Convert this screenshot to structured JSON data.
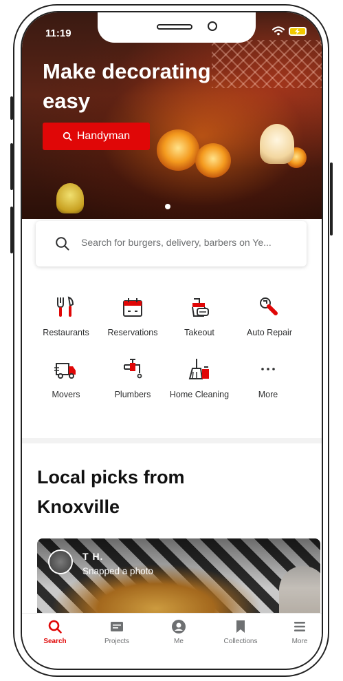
{
  "status_bar": {
    "time": "11:19"
  },
  "hero": {
    "title": "Make decorating easy",
    "button_label": "Handyman"
  },
  "search": {
    "placeholder": "Search for burgers, delivery, barbers on Ye..."
  },
  "categories": [
    {
      "label": "Restaurants",
      "icon": "utensils-icon"
    },
    {
      "label": "Reservations",
      "icon": "calendar-icon"
    },
    {
      "label": "Takeout",
      "icon": "takeout-icon"
    },
    {
      "label": "Auto Repair",
      "icon": "wrench-icon"
    },
    {
      "label": "Movers",
      "icon": "truck-icon"
    },
    {
      "label": "Plumbers",
      "icon": "faucet-icon"
    },
    {
      "label": "Home Cleaning",
      "icon": "broom-icon"
    },
    {
      "label": "More",
      "icon": "more-dots-icon"
    }
  ],
  "local_picks": {
    "title": "Local picks from Knoxville",
    "card": {
      "user": "T H.",
      "action": "Snapped a photo"
    }
  },
  "tabbar": {
    "items": [
      {
        "label": "Search",
        "active": true
      },
      {
        "label": "Projects",
        "active": false
      },
      {
        "label": "Me",
        "active": false
      },
      {
        "label": "Collections",
        "active": false
      },
      {
        "label": "More",
        "active": false
      }
    ]
  },
  "colors": {
    "brand_red": "#e00707",
    "text_gray": "#6e7072"
  }
}
